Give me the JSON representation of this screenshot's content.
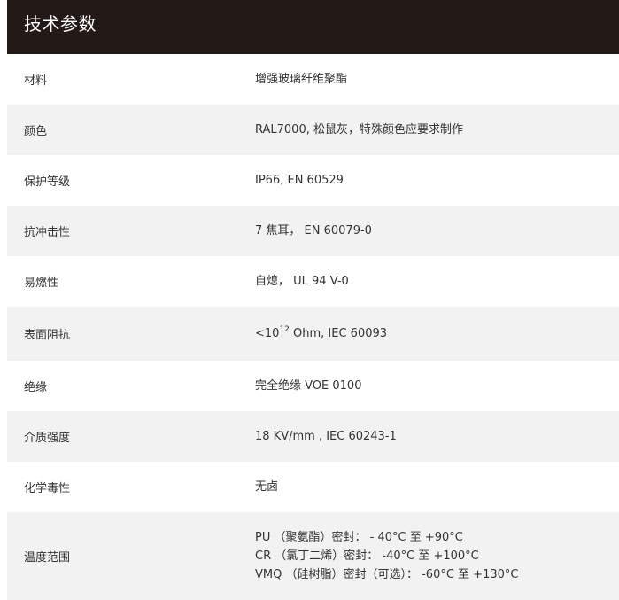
{
  "header": {
    "title": "技术参数"
  },
  "rows": [
    {
      "label": "材料",
      "value": "增强玻璃纤维聚酯"
    },
    {
      "label": "颜色",
      "value": "RAL7000, 松鼠灰，特殊颜色应要求制作"
    },
    {
      "label": "保护等级",
      "value": "IP66, EN 60529"
    },
    {
      "label": "抗冲击性",
      "value": "7 焦耳，  EN 60079-0"
    },
    {
      "label": "易燃性",
      "value": "自熄，  UL 94 V-0"
    },
    {
      "label": "表面阻抗",
      "value_prefix": "<10",
      "value_exponent": "12",
      "value_suffix": " Ohm, IEC 60093"
    },
    {
      "label": "绝缘",
      "value": "完全绝缘 VOE 0100"
    },
    {
      "label": "介质强度",
      "value": "18 KV/mm , IEC 60243-1"
    },
    {
      "label": "化学毒性",
      "value": "无卤"
    },
    {
      "label": "温度范围",
      "lines": [
        "PU （聚氨酯）密封： - 40°C 至 +90°C",
        "CR （氯丁二烯）密封： -40°C 至 +100°C",
        "VMQ （硅树脂）密封（可选）：  -60°C 至 +130°C"
      ]
    }
  ]
}
